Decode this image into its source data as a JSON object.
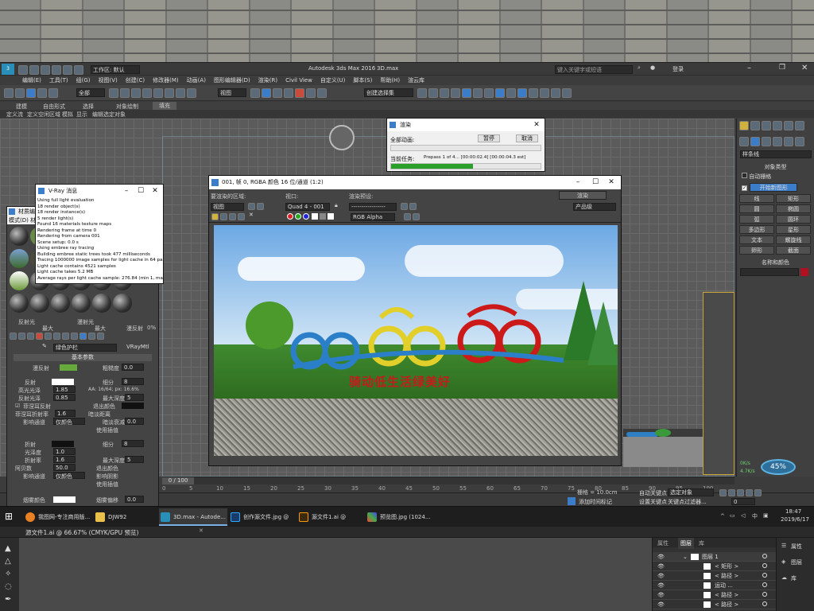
{
  "max": {
    "title": "Autodesk 3ds Max 2016",
    "file": "3D.max",
    "workspace_label": "工作区: 默认",
    "search_placeholder": "键入关键字或短语",
    "login": "登录",
    "menu": [
      "编辑(E)",
      "工具(T)",
      "组(G)",
      "视图(V)",
      "创建(C)",
      "修改器(M)",
      "动画(A)",
      "图形编辑器(D)",
      "渲染(R)",
      "Civil View",
      "自定义(U)",
      "脚本(S)",
      "帮助(H)",
      "渲云库"
    ],
    "toolbar_selects": {
      "filter": "全部",
      "view": "视图",
      "selset": "创建选择集"
    },
    "ribbon_tabs": [
      "建模",
      "自由形式",
      "选择",
      "对象绘制",
      "填充"
    ],
    "ribbon_sub": [
      "定义流",
      "定义空闲区域",
      "模拟",
      "显示",
      "编辑选定对象"
    ],
    "frame_counter": "0 / 100",
    "timeline_ticks": [
      "0",
      "5",
      "10",
      "15",
      "20",
      "25",
      "30",
      "35",
      "40",
      "45",
      "50",
      "55",
      "60",
      "65",
      "70",
      "75",
      "80",
      "85",
      "90",
      "95",
      "100"
    ],
    "grid_label": "栅格 = 10.0cm",
    "auto_key": "自动关键点",
    "set_key": "设置关键点",
    "selected_object": "选定对象",
    "key_filter": "关键点过滤器...",
    "add_time_tag": "添加时间标记",
    "frame_num": "0",
    "percent": "45%",
    "speed_up": "4.7K/s",
    "speed_down": "0K/s"
  },
  "command_panel": {
    "dropdown": "样条线",
    "object_type": "对象类型",
    "auto_grid": "自动栅格",
    "start_new_shape": "开始新图形",
    "shapes": [
      "线",
      "矩形",
      "圆",
      "椭圆",
      "弧",
      "圆环",
      "多边形",
      "星形",
      "文本",
      "螺旋线",
      "卵形",
      "截面"
    ],
    "name_color": "名称和颜色"
  },
  "render_progress": {
    "title": "渲染",
    "all_anim": "全部动画:",
    "pause": "暂停",
    "cancel": "取消",
    "current_task": "当前任务:",
    "task_text": "Prepass 1 of 4... [00:00:02.4] [00:00:04.3 est]",
    "overall_progress": 0,
    "task_progress": 0.55
  },
  "frame_window": {
    "title": "001, 帧 0, RGBA 颜色 16 位/通道 (1:2)",
    "area_label": "要渲染的区域:",
    "area_value": "视图",
    "viewport_label": "视口:",
    "viewport_value": "Quad 4 - 001",
    "preset_label": "渲染预设:",
    "preset_value": "-----------------",
    "render_btn": "渲染",
    "product_value": "产品级",
    "channel": "RGB Alpha",
    "sign_text": "骑动低生活绿美好"
  },
  "vray_log": {
    "title": "V-Ray 消息",
    "lines": [
      "Using full light evaluation",
      "18 render object(s)",
      "18 render instance(s)",
      "5 render light(s)",
      "Found 16 materials texture maps",
      "Rendering frame at time 0",
      "Rendering from camera 001",
      "Scene setup: 0.0 s",
      "Using embree ray tracing",
      "Building embree static trees took 477 milliseconds",
      "Tracing 1000000 image samples for light cache in 64 passes",
      "Light cache contains 4521 samples",
      "Light cache takes 5.2 MB",
      "Average rays per light cache sample: 276.84 (min 1, max 25)"
    ]
  },
  "material_editor": {
    "title": "材质编",
    "menu": "模式(D)  材质",
    "material_name": "绿色护栏",
    "renderer_type": "VRayMtl",
    "top_labels": {
      "refl_group": "反射光",
      "refr_group": "漫射光",
      "max": "最大",
      "min": "最小",
      "reflection": "漫反射",
      "pct": "0%"
    },
    "basic_params": "基本参数",
    "diffuse": "漫反射",
    "roughness": "粗糙度",
    "roughness_val": "0.0",
    "reflect": "反射",
    "hilight_gloss": "高光光泽",
    "hilight_val": "1.85",
    "refl_gloss": "反射光泽",
    "refl_gloss_val": "0.85",
    "fresnel": "菲涅耳反射",
    "fresnel_ior": "菲涅耳折射率",
    "fresnel_ior_val": "1.6",
    "affect_channel": "影响通道",
    "only_color": "仅颜色",
    "subdivs": "细分",
    "subdivs_val": "8",
    "aa_text": "AA: 16/64; px: 16.6%",
    "max_depth": "最大深度",
    "max_depth_val": "5",
    "exit_color": "退出颜色",
    "dim_distance": "暗淡距离",
    "dim_falloff": "暗淡衰减",
    "dim_falloff_val": "0.0",
    "use_interp": "使用插值",
    "refract": "折射",
    "gloss": "光泽度",
    "gloss_val": "1.0",
    "ior": "折射率",
    "ior_val": "1.6",
    "abbe": "阿贝数",
    "abbe_val": "50.0",
    "refr_subdivs": "细分",
    "refr_subdivs_val": "8",
    "refr_max_depth": "最大深度",
    "refr_max_depth_val": "5",
    "refr_exit": "退出颜色",
    "affect_shadows": "影响阴影",
    "use_interp2": "使用插值",
    "fog_color": "烟雾颜色",
    "fog_bias": "烟雾偏移",
    "fog_bias_val": "0.0"
  },
  "taskbar": {
    "items": [
      "我图网-专注商用版...",
      "DJW92",
      "3D.max - Autode...",
      "创作源文件.jpg @ ...",
      "源文件1.ai @ 66.6...",
      "预览图.jpg (1024..."
    ],
    "time": "18:47",
    "date": "2019/6/17"
  },
  "illustrator": {
    "doc_title": "源文件1.ai @ 66.67% (CMYK/GPU 预览)",
    "panel_tabs": [
      "属性",
      "图层",
      "库"
    ],
    "layer_name": "图层 1",
    "layers": [
      "< 矩形 >",
      "< 路径 >",
      "运动 ...",
      "< 路径 >",
      "< 路径 >"
    ],
    "right_tabs": [
      "属性",
      "图层",
      "库"
    ]
  },
  "colors": {
    "accent_blue": "#3b7dc8",
    "progress_green": "#2aa02a",
    "swatch_red": "#b01020"
  }
}
